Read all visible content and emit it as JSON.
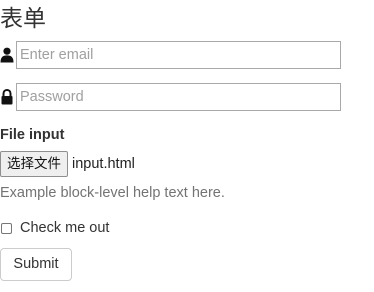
{
  "form": {
    "title": "表单",
    "email": {
      "icon": "user-icon",
      "placeholder": "Enter email",
      "value": ""
    },
    "password": {
      "icon": "lock-icon",
      "placeholder": "Password",
      "value": ""
    },
    "file": {
      "label": "File input",
      "button_label": "选择文件",
      "file_name": "input.html",
      "help_text": "Example block-level help text here."
    },
    "checkbox": {
      "label": "Check me out",
      "checked": false
    },
    "submit_label": "Submit"
  },
  "colors": {
    "text": "#333333",
    "help_text": "#737373",
    "input_border": "#a9a9a9",
    "placeholder": "#a0a0a0"
  }
}
